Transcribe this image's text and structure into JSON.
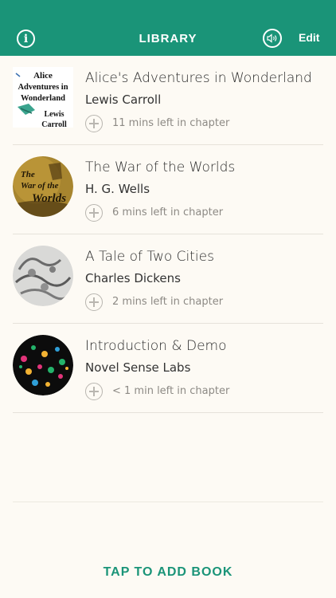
{
  "header": {
    "title": "LIBRARY",
    "info_icon": "info-icon",
    "info_glyph": "i",
    "sound_icon": "speaker-icon",
    "edit_label": "Edit",
    "background": "#1a9478"
  },
  "books": [
    {
      "title": "Alice's Adventures in Wonderland",
      "author": "Lewis Carroll",
      "time_left": "11 mins left in chapter",
      "cover_text": [
        "Alice",
        "Adventures in",
        "Wonderland",
        "Lewis",
        "Carroll"
      ]
    },
    {
      "title": "The War of the Worlds",
      "author": "H. G. Wells",
      "time_left": "6 mins left in chapter",
      "cover_text": [
        "The",
        "War of the",
        "Worlds"
      ]
    },
    {
      "title": "A Tale of Two Cities",
      "author": "Charles Dickens",
      "time_left": "2 mins left in chapter"
    },
    {
      "title": "Introduction & Demo",
      "author": "Novel Sense Labs",
      "time_left": "< 1 min left in chapter"
    }
  ],
  "footer": {
    "add_book_label": "TAP TO ADD BOOK",
    "accent": "#1a9478"
  }
}
